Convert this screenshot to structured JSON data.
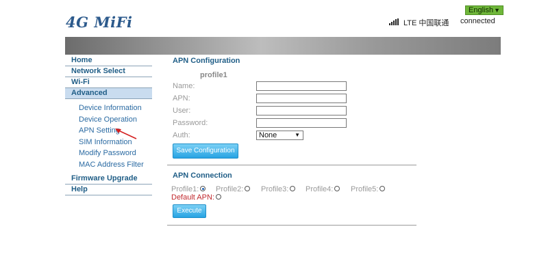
{
  "header": {
    "logo_text": "4G MiFi",
    "language": "English",
    "network_type": "LTE 中国联通",
    "connection_status": "connected"
  },
  "sidebar": {
    "items": [
      {
        "label": "Home"
      },
      {
        "label": "Network Select"
      },
      {
        "label": "Wi-Fi"
      },
      {
        "label": "Advanced"
      },
      {
        "label": "Firmware Upgrade"
      },
      {
        "label": "Help"
      }
    ],
    "sub_items": [
      {
        "label": "Device Information"
      },
      {
        "label": "Device Operation"
      },
      {
        "label": "APN Setting"
      },
      {
        "label": "SIM Information"
      },
      {
        "label": "Modify Password"
      },
      {
        "label": "MAC Address Filter"
      }
    ]
  },
  "apn_config": {
    "title": "APN Configuration",
    "profile_heading": "profile1",
    "fields": {
      "name_label": "Name:",
      "name_value": "",
      "apn_label": "APN:",
      "apn_value": "",
      "user_label": "User:",
      "user_value": "",
      "password_label": "Password:",
      "password_value": "",
      "auth_label": "Auth:",
      "auth_value": "None"
    },
    "save_button": "Save Configuration"
  },
  "apn_connection": {
    "title": "APN Connection",
    "profiles": [
      {
        "label": "Profile1:",
        "selected": true
      },
      {
        "label": "Profile2:",
        "selected": false
      },
      {
        "label": "Profile3:",
        "selected": false
      },
      {
        "label": "Profile4:",
        "selected": false
      },
      {
        "label": "Profile5:",
        "selected": false
      }
    ],
    "default_apn_label": "Default APN:",
    "execute_button": "Execute"
  },
  "colors": {
    "nav_text": "#1f5d86",
    "link_text": "#2a6aa2",
    "active_nav_bg": "#c9dcef",
    "button_bg": "#27a3e3",
    "language_bg": "#6fb73a",
    "default_apn_text": "#c0282d"
  }
}
